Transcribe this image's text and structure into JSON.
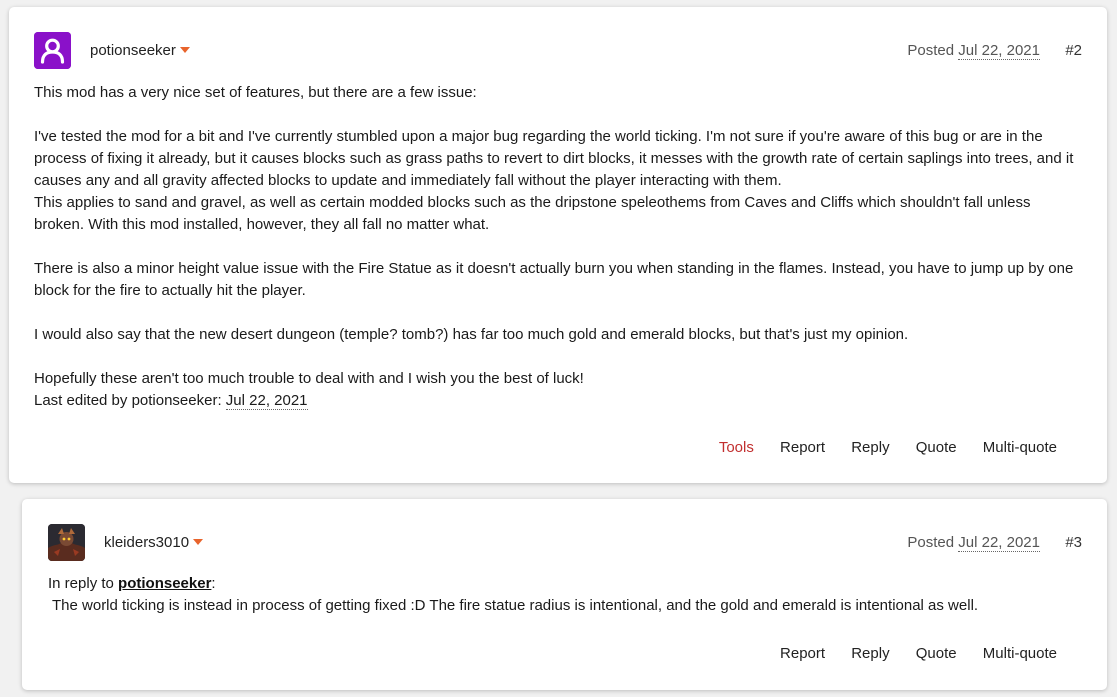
{
  "posts": [
    {
      "username": "potionseeker",
      "posted_prefix": "Posted",
      "date": "Jul 22, 2021",
      "number": "#2",
      "avatar_icon": "person-outline-icon",
      "avatar_color": "#8a11c9",
      "paragraphs": [
        "This mod has a very nice set of features, but there are a few issue:",
        "I've tested the mod for a bit and I've currently stumbled upon a major bug regarding the world ticking. I'm not sure if you're aware of this bug or are in the process of fixing it already, but it causes blocks such as grass paths to revert to dirt blocks, it messes with the growth rate of certain saplings into trees, and it causes any and all gravity affected blocks to update and immediately fall without the player interacting with them.",
        "This applies to sand and gravel, as well as certain modded blocks such as the dripstone speleothems from Caves and Cliffs which shouldn't fall unless broken. With this mod installed, however, they all fall no matter what.",
        "There is also a minor height value issue with the Fire Statue as it doesn't actually burn you when standing in the flames. Instead, you have to jump up by one block for the fire to actually hit the player.",
        "I would also say that the new desert dungeon (temple? tomb?) has far too much gold and emerald blocks, but that's just my opinion.",
        "Hopefully these aren't too much trouble to deal with and I wish you the best of luck!"
      ],
      "edited_prefix": "Last edited by potionseeker:",
      "edited_date": "Jul 22, 2021",
      "actions": {
        "tools": "Tools",
        "report": "Report",
        "reply": "Reply",
        "quote": "Quote",
        "multiquote": "Multi-quote"
      }
    },
    {
      "username": "kleiders3010",
      "posted_prefix": "Posted",
      "date": "Jul 22, 2021",
      "number": "#3",
      "in_reply_prefix": "In reply to",
      "in_reply_user": "potionseeker",
      "in_reply_suffix": ":",
      "text": "The world ticking is instead in process of getting fixed :D The fire statue radius is intentional, and the gold and emerald is intentional as well.",
      "actions": {
        "report": "Report",
        "reply": "Reply",
        "quote": "Quote",
        "multiquote": "Multi-quote"
      }
    }
  ],
  "colors": {
    "accent_caret": "#e8642c",
    "tools_link": "#c22f2f"
  }
}
